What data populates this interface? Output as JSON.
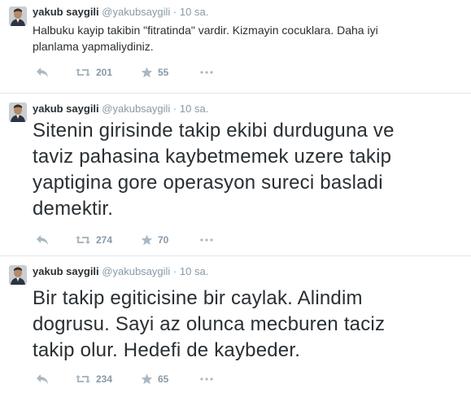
{
  "tweets": [
    {
      "fullname": "yakub saygili",
      "screenname": "@yakubsaygili",
      "separator": "·",
      "time": "10 sa.",
      "text": "Halbuku kayip takibin  \"fitratinda\" vardir. Kizmayin cocuklara. Daha iyi\nplanlama yapmaliydiniz.",
      "retweets": "201",
      "favorites": "55"
    },
    {
      "fullname": "yakub saygili",
      "screenname": "@yakubsaygili",
      "separator": "·",
      "time": "10 sa.",
      "text": "Sitenin girisinde takip ekibi durduguna ve\ntaviz pahasina kaybetmemek uzere takip\nyaptigina gore operasyon sureci basladi\ndemektir.",
      "retweets": "274",
      "favorites": "70"
    },
    {
      "fullname": "yakub saygili",
      "screenname": "@yakubsaygili",
      "separator": "·",
      "time": "10 sa.",
      "text": "Bir takip egiticisine bir caylak. Alindim\ndogrusu. Sayi az olunca mecburen taciz\ntakip olur. Hedefi de kaybeder.",
      "retweets": "234",
      "favorites": "65"
    }
  ],
  "icons": {
    "reply": "reply-icon",
    "retweet": "retweet-icon",
    "favorite": "star-icon",
    "more": "more-icon"
  },
  "colors": {
    "text": "#292f33",
    "muted": "#8899a6",
    "icon": "#aab8c2",
    "divider": "#e1e8ed"
  }
}
